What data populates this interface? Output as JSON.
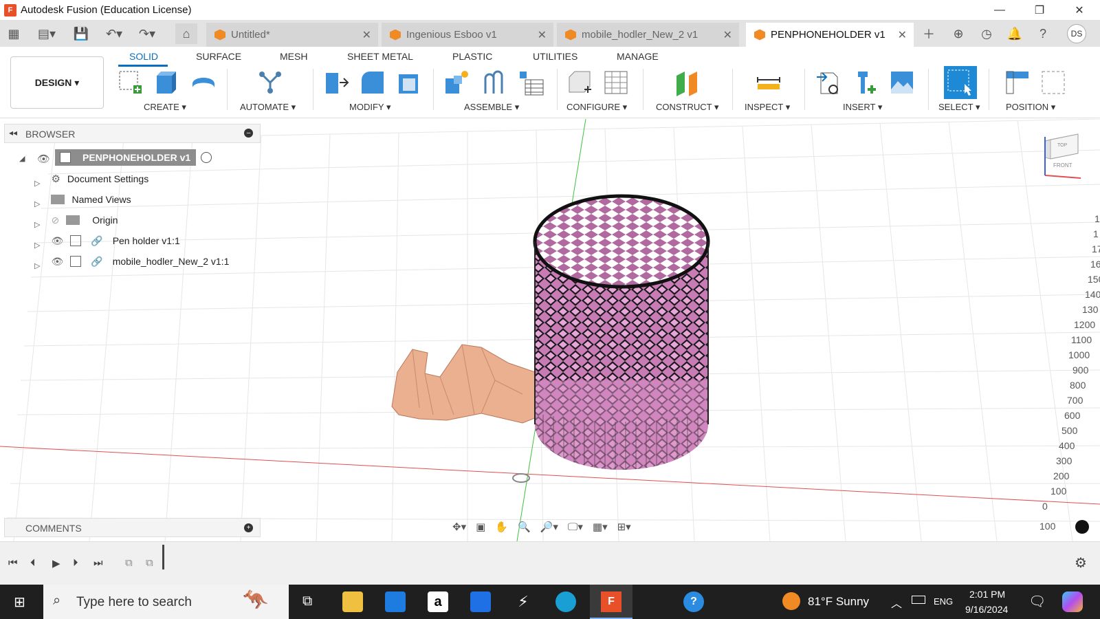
{
  "window": {
    "title": "Autodesk Fusion (Education License)",
    "minimize_icon": "—",
    "restore_icon": "❐",
    "close_icon": "✕"
  },
  "tabs": [
    {
      "label": "Untitled*"
    },
    {
      "label": "Ingenious Esboo v1"
    },
    {
      "label": "mobile_hodler_New_2 v1"
    },
    {
      "label": "PENPHONEHOLDER v1"
    }
  ],
  "user": {
    "initials": "DS"
  },
  "ribbon": {
    "tabs": [
      "SOLID",
      "SURFACE",
      "MESH",
      "SHEET METAL",
      "PLASTIC",
      "UTILITIES",
      "MANAGE"
    ],
    "workspace": "DESIGN",
    "groups": [
      "CREATE",
      "AUTOMATE",
      "MODIFY",
      "ASSEMBLE",
      "CONFIGURE",
      "CONSTRUCT",
      "INSPECT",
      "INSERT",
      "SELECT",
      "POSITION"
    ]
  },
  "browser": {
    "title": "BROWSER",
    "root": "PENPHONEHOLDER v1",
    "items": [
      {
        "label": "Document Settings",
        "icon": "gear-icon"
      },
      {
        "label": "Named Views",
        "icon": "folder-icon"
      },
      {
        "label": "Origin",
        "icon": "folder-icon"
      },
      {
        "label": "Pen holder v1:1",
        "icon": "component-icon"
      },
      {
        "label": "mobile_hodler_New_2 v1:1",
        "icon": "component-icon"
      }
    ]
  },
  "comments": {
    "title": "COMMENTS"
  },
  "viewcube": {
    "top": "TOP",
    "front": "FRONT"
  },
  "ruler_ticks": [
    "1",
    "1",
    "17",
    "16",
    "150",
    "140",
    "130",
    "1200",
    "1100",
    "1000",
    "900",
    "800",
    "700",
    "600",
    "500",
    "400",
    "300",
    "200",
    "100",
    "0",
    "100"
  ],
  "taskbar": {
    "search_placeholder": "Type here to search",
    "weather": "81°F  Sunny",
    "language": "ENG",
    "time": "2:01 PM",
    "date": "9/16/2024"
  },
  "colors": {
    "accent": "#0a6fc2",
    "pen_holder": "#d98fc9",
    "phone_holder": "#eab08f",
    "axis_green": "#3fbf3f",
    "axis_red": "#e05050"
  }
}
